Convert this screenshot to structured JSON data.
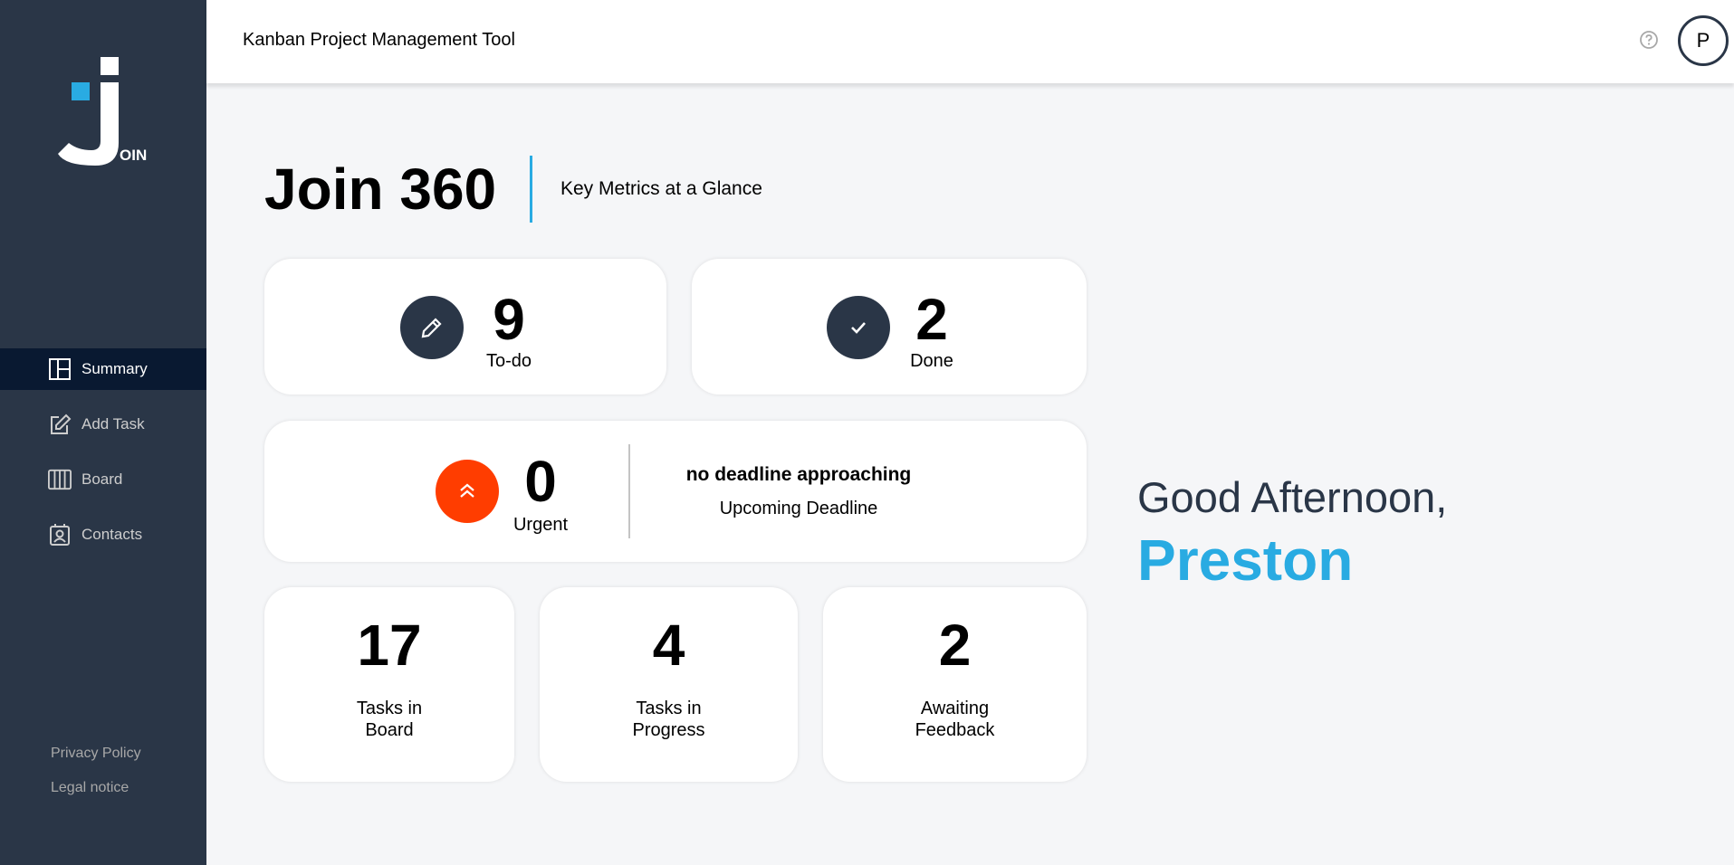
{
  "app": {
    "header_title": "Kanban Project Management Tool",
    "user_initial": "P",
    "logo_text": "OIN"
  },
  "colors": {
    "sidebar_bg": "#2A3647",
    "active_nav_bg": "#091931",
    "accent": "#29ABE2",
    "urgent": "#FF3D00"
  },
  "sidebar": {
    "items": [
      {
        "label": "Summary",
        "icon": "summary-icon",
        "active": true
      },
      {
        "label": "Add Task",
        "icon": "add-task-icon",
        "active": false
      },
      {
        "label": "Board",
        "icon": "board-icon",
        "active": false
      },
      {
        "label": "Contacts",
        "icon": "contacts-icon",
        "active": false
      }
    ],
    "footer": {
      "privacy": "Privacy Policy",
      "legal": "Legal notice"
    }
  },
  "summary": {
    "title": "Join 360",
    "subtitle": "Key Metrics at a Glance",
    "todo": {
      "count": "9",
      "label": "To-do",
      "icon": "pencil-icon"
    },
    "done": {
      "count": "2",
      "label": "Done",
      "icon": "checkmark-icon"
    },
    "urgent": {
      "count": "0",
      "label": "Urgent",
      "icon": "double-chevron-up-icon",
      "deadline_value": "no deadline approaching",
      "deadline_label": "Upcoming Deadline"
    },
    "stats": {
      "board": {
        "count": "17",
        "label_line1": "Tasks in",
        "label_line2": "Board"
      },
      "progress": {
        "count": "4",
        "label_line1": "Tasks in",
        "label_line2": "Progress"
      },
      "feedback": {
        "count": "2",
        "label_line1": "Awaiting",
        "label_line2": "Feedback"
      }
    }
  },
  "greeting": {
    "text": "Good Afternoon,",
    "name": "Preston"
  }
}
